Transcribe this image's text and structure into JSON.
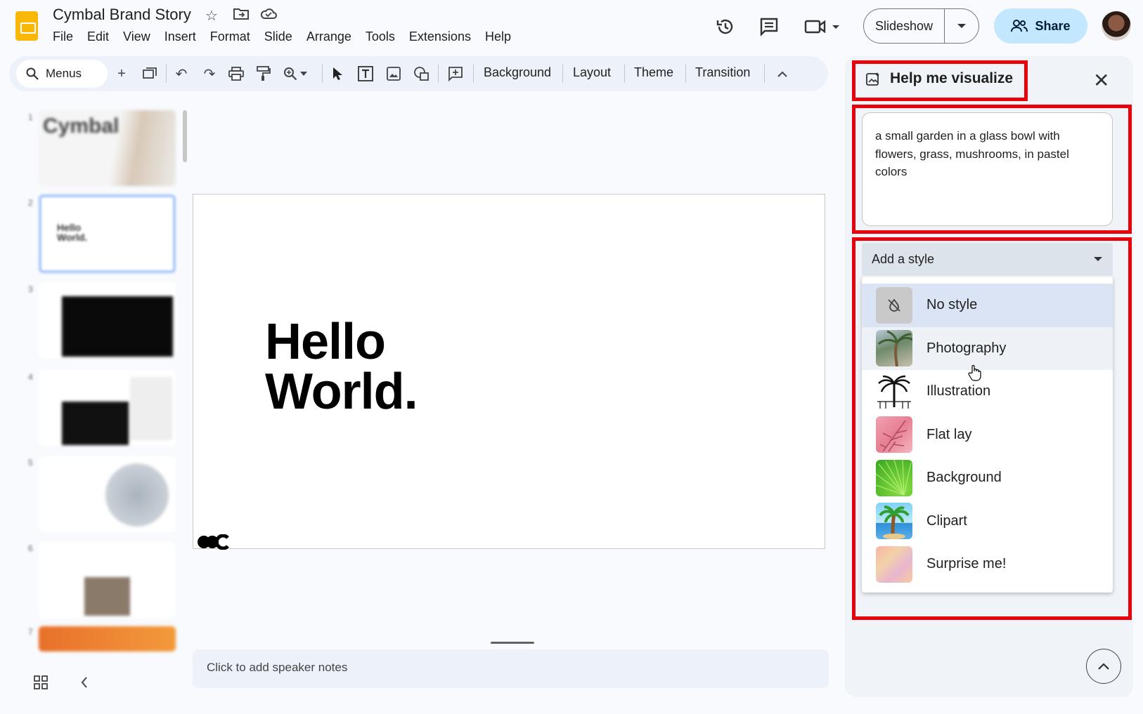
{
  "app": {
    "doc_title": "Cymbal Brand Story",
    "menu": [
      "File",
      "Edit",
      "View",
      "Insert",
      "Format",
      "Slide",
      "Arrange",
      "Tools",
      "Extensions",
      "Help"
    ],
    "slideshow_label": "Slideshow",
    "share_label": "Share"
  },
  "toolbar": {
    "menus_label": "Menus",
    "background_label": "Background",
    "layout_label": "Layout",
    "theme_label": "Theme",
    "transition_label": "Transition"
  },
  "filmstrip": {
    "slide_numbers": [
      "1",
      "2",
      "3",
      "4",
      "5",
      "6",
      "7"
    ]
  },
  "slide": {
    "heading_line1": "Hello",
    "heading_line2": "World."
  },
  "notes": {
    "placeholder": "Click to add speaker notes"
  },
  "panel": {
    "title": "Help me visualize",
    "prompt": "a small garden in a glass bowl with flowers, grass, mushrooms, in pastel colors",
    "style_select_label": "Add a style",
    "styles": [
      {
        "label": "No style",
        "icon": "no-style-icon"
      },
      {
        "label": "Photography",
        "icon": "photography-thumb"
      },
      {
        "label": "Illustration",
        "icon": "illustration-thumb"
      },
      {
        "label": "Flat lay",
        "icon": "flat-lay-thumb"
      },
      {
        "label": "Background",
        "icon": "background-thumb"
      },
      {
        "label": "Clipart",
        "icon": "clipart-thumb"
      },
      {
        "label": "Surprise me!",
        "icon": "surprise-thumb"
      }
    ],
    "selected_style": "No style"
  },
  "colors": {
    "highlight_border": "#e8000b",
    "share_button": "#c2e7ff",
    "slides_logo": "#f9b707"
  }
}
